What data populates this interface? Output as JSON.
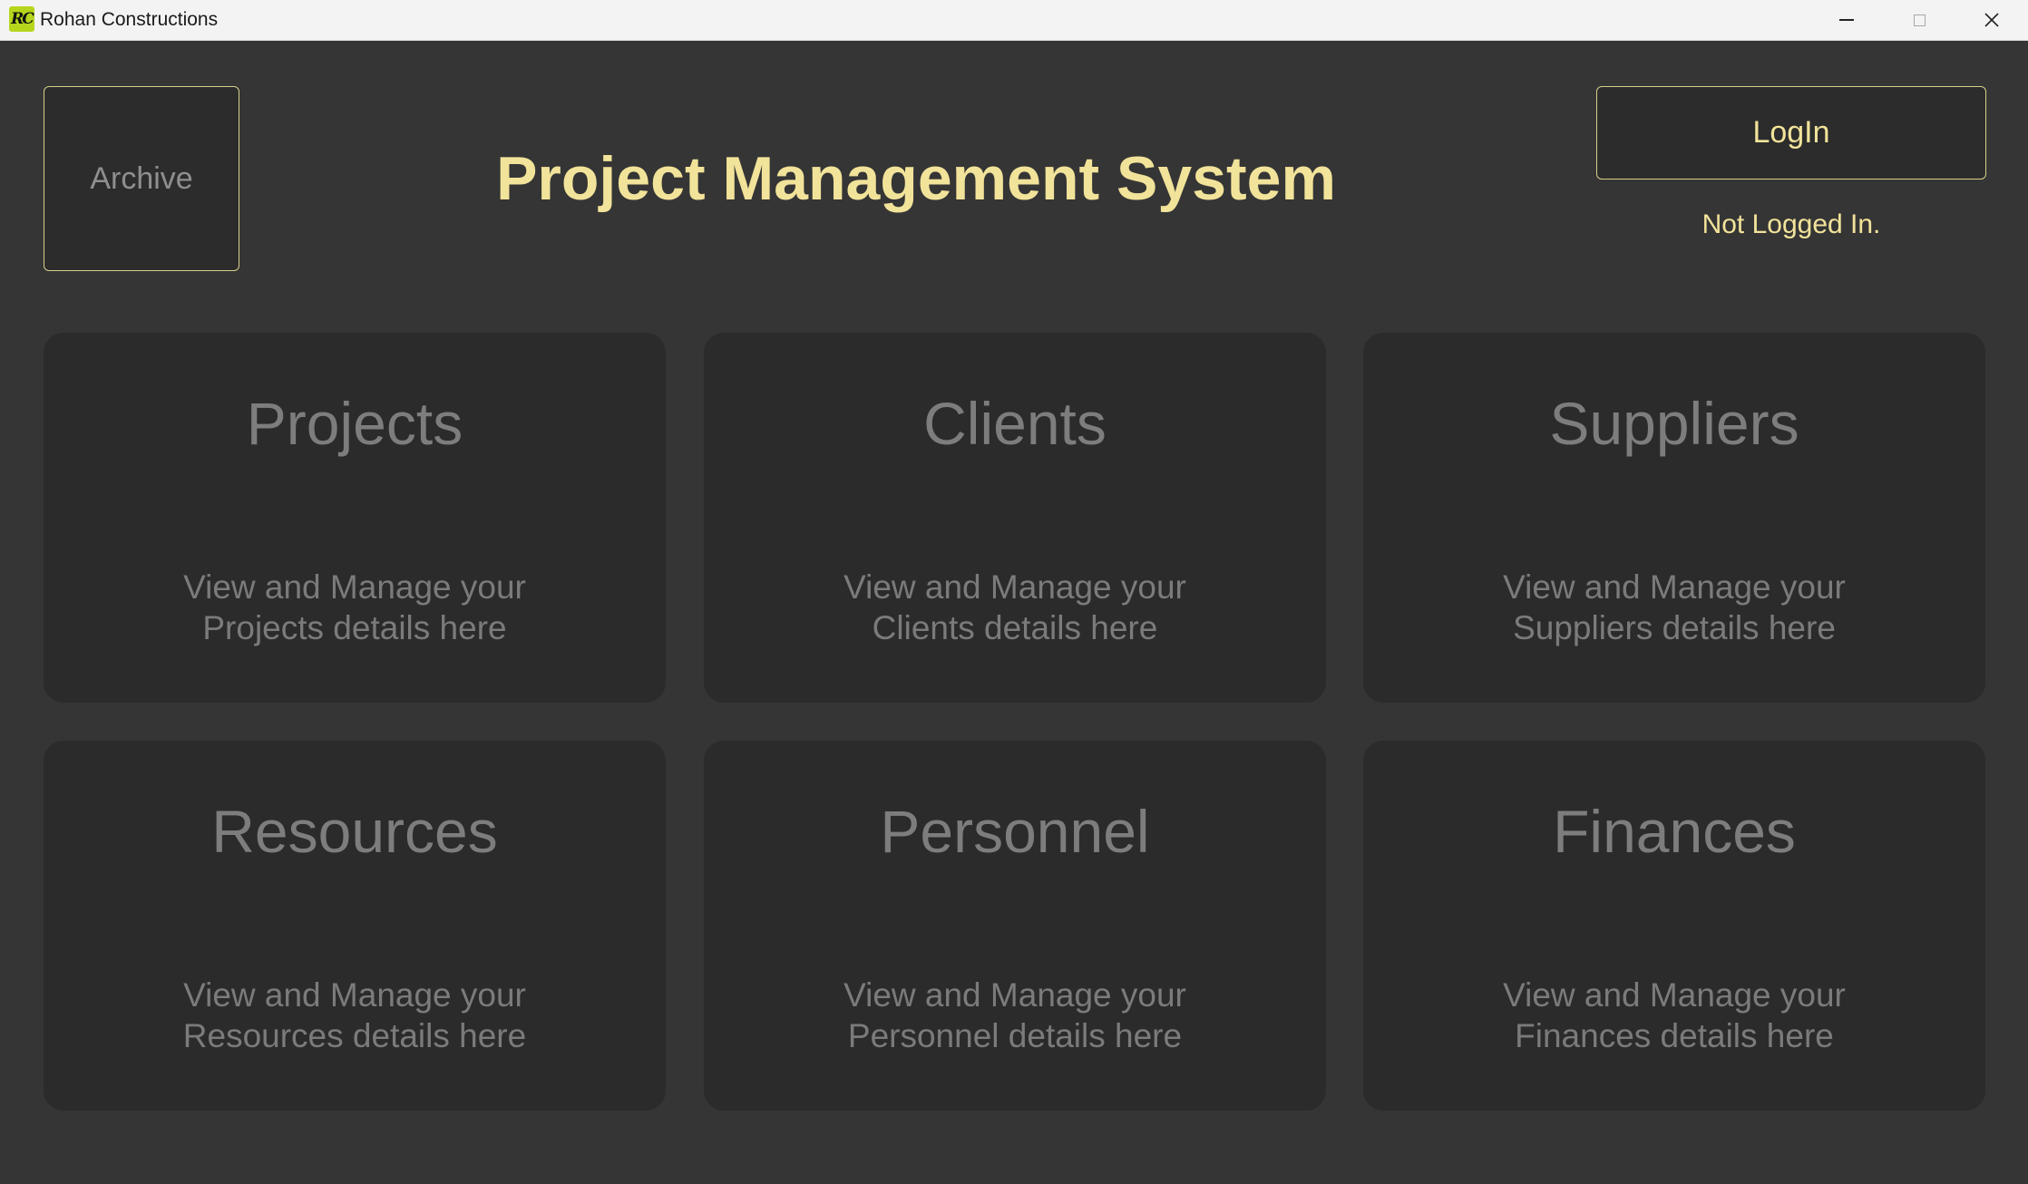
{
  "window": {
    "title": "Rohan Constructions",
    "icon_name": "rohan-constructions-logo-icon",
    "icon_text": "RC",
    "icon_color": "#b5d61c"
  },
  "header": {
    "archive_label": "Archive",
    "title": "Project Management System",
    "login_label": "LogIn",
    "login_status": "Not Logged In."
  },
  "colors": {
    "background": "#353535",
    "card_background": "#2b2b2b",
    "accent": "#f2e39a",
    "muted_text": "#7d7d7d"
  },
  "cards": [
    {
      "title": "Projects",
      "desc_line1": "View and Manage your",
      "desc_line2": "Projects details here"
    },
    {
      "title": "Clients",
      "desc_line1": "View and Manage your",
      "desc_line2": "Clients details here"
    },
    {
      "title": "Suppliers",
      "desc_line1": "View and Manage your",
      "desc_line2": "Suppliers details here"
    },
    {
      "title": "Resources",
      "desc_line1": "View and Manage your",
      "desc_line2": "Resources details here"
    },
    {
      "title": "Personnel",
      "desc_line1": "View and Manage your",
      "desc_line2": "Personnel details here"
    },
    {
      "title": "Finances",
      "desc_line1": "View and Manage your",
      "desc_line2": "Finances details here"
    }
  ]
}
